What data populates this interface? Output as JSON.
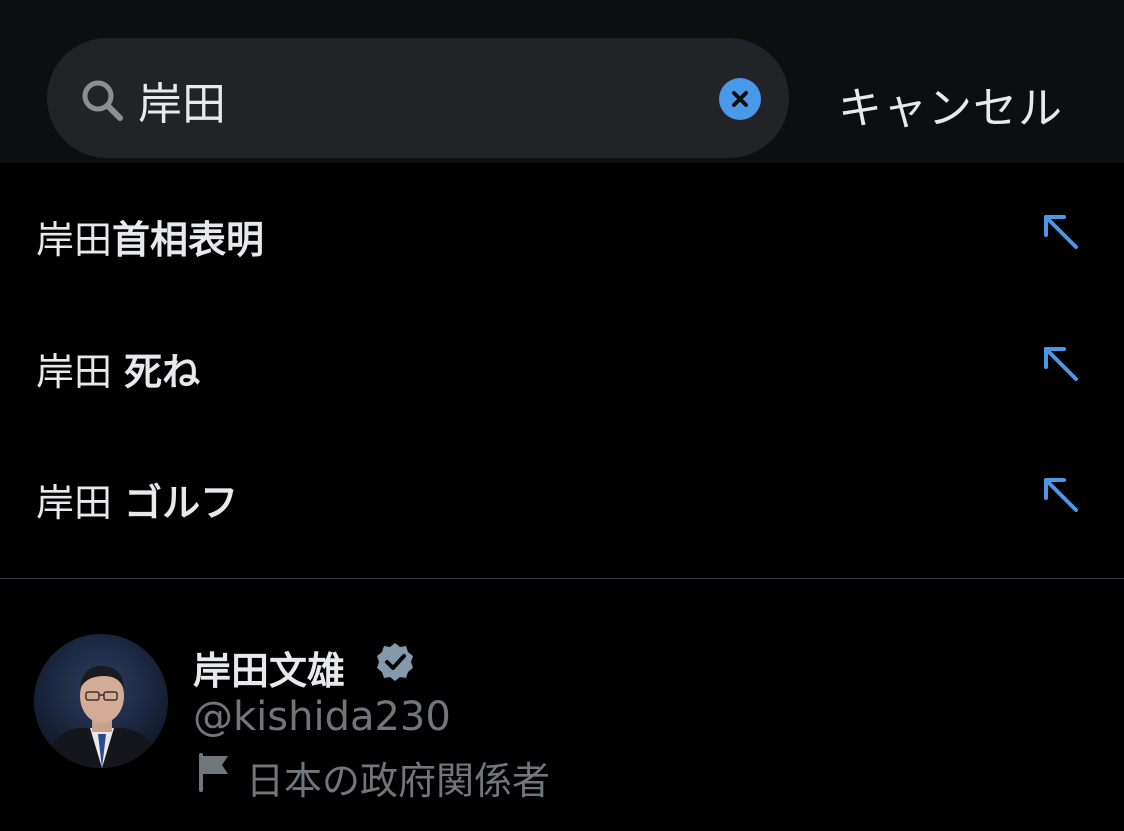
{
  "search": {
    "query": "岸田",
    "cancel_label": "キャンセル"
  },
  "suggestions": [
    {
      "prefix": "岸田",
      "suffix": "首相表明"
    },
    {
      "prefix": "岸田 ",
      "suffix": "死ね"
    },
    {
      "prefix": "岸田 ",
      "suffix": "ゴルフ"
    }
  ],
  "user_result": {
    "name": "岸田文雄",
    "handle": "@kishida230",
    "label": "日本の政府関係者",
    "verified": true
  },
  "colors": {
    "accent": "#4a99e9",
    "secondary_text": "#71767b",
    "verified_badge": "#829aab"
  }
}
